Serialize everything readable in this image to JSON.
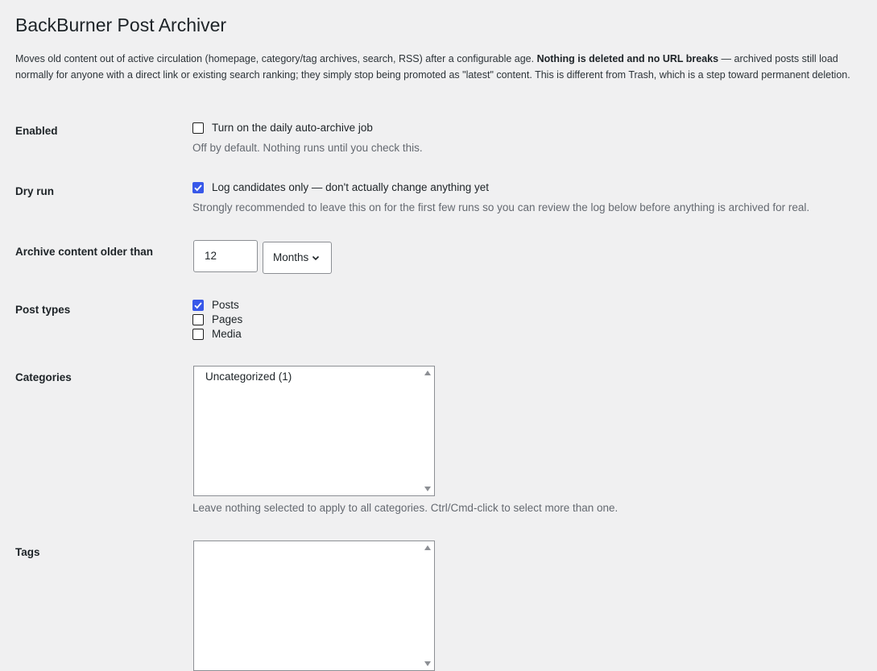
{
  "page": {
    "title": "BackBurner Post Archiver",
    "intro_before": "Moves old content out of active circulation (homepage, category/tag archives, search, RSS) after a configurable age. ",
    "intro_bold": "Nothing is deleted and no URL breaks",
    "intro_after": " — archived posts still load normally for anyone with a direct link or existing search ranking; they simply stop being promoted as \"latest\" content. This is different from Trash, which is a step toward permanent deletion."
  },
  "enabled": {
    "label": "Enabled",
    "checkbox_label": "Turn on the daily auto-archive job",
    "checked": false,
    "description": "Off by default. Nothing runs until you check this."
  },
  "dry_run": {
    "label": "Dry run",
    "checkbox_label": "Log candidates only — don't actually change anything yet",
    "checked": true,
    "description": "Strongly recommended to leave this on for the first few runs so you can review the log below before anything is archived for real."
  },
  "age": {
    "label": "Archive content older than",
    "value": "12",
    "unit": "Months"
  },
  "post_types": {
    "label": "Post types",
    "items": [
      {
        "label": "Posts",
        "checked": true
      },
      {
        "label": "Pages",
        "checked": false
      },
      {
        "label": "Media",
        "checked": false
      }
    ]
  },
  "categories": {
    "label": "Categories",
    "options": [
      "Uncategorized (1)"
    ],
    "help": "Leave nothing selected to apply to all categories. Ctrl/Cmd-click to select more than one."
  },
  "tags": {
    "label": "Tags",
    "options": []
  },
  "colors": {
    "accent": "#3858e9",
    "background": "#f0f0f1",
    "text": "#1d2327",
    "muted": "#646970"
  }
}
